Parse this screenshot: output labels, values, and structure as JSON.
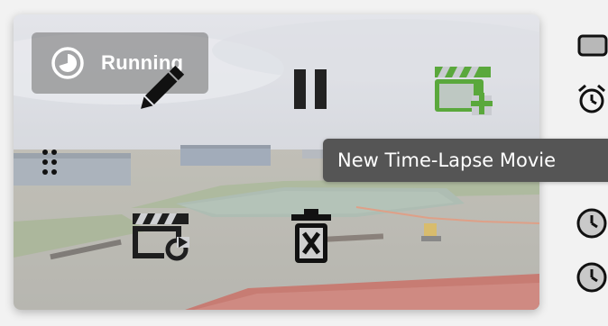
{
  "status": {
    "label": "Running",
    "icon": "progress-clock-icon"
  },
  "actions": {
    "edit": {
      "icon": "pencil-icon"
    },
    "pause": {
      "icon": "pause-icon"
    },
    "new_timelapse": {
      "icon": "movie-add-icon",
      "color": "#5aa83c"
    },
    "regenerate": {
      "icon": "movie-refresh-icon"
    },
    "delete": {
      "icon": "trash-x-icon"
    }
  },
  "tooltip": {
    "text": "New Time-Lapse Movie"
  },
  "side_icons": [
    "camera-frame-icon",
    "alarm-clock-icon",
    "clock-icon",
    "clock-icon"
  ],
  "colors": {
    "tooltip_bg": "#555555",
    "icon_dark": "#222222",
    "accent_green": "#5aa83c"
  }
}
